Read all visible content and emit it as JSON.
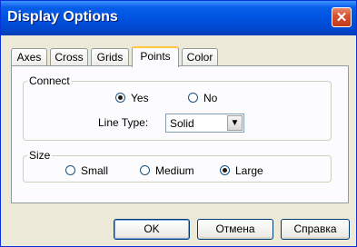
{
  "window": {
    "title": "Display Options",
    "close_glyph": "✕"
  },
  "tabs": [
    {
      "label": "Axes"
    },
    {
      "label": "Cross"
    },
    {
      "label": "Grids"
    },
    {
      "label": "Points",
      "active": true
    },
    {
      "label": "Color"
    }
  ],
  "connect": {
    "legend": "Connect",
    "options": [
      {
        "label": "Yes",
        "selected": true
      },
      {
        "label": "No",
        "selected": false
      }
    ],
    "line_type_label": "Line Type:",
    "line_type_value": "Solid"
  },
  "size": {
    "legend": "Size",
    "options": [
      {
        "label": "Small",
        "selected": false
      },
      {
        "label": "Medium",
        "selected": false
      },
      {
        "label": "Large",
        "selected": true
      }
    ]
  },
  "buttons": {
    "ok": "OK",
    "cancel": "Отмена",
    "help": "Справка"
  },
  "colors": {
    "title_bar": "#0054e3",
    "accent_tab": "#ffc83c",
    "radio_checked": "#1a1a1a"
  }
}
